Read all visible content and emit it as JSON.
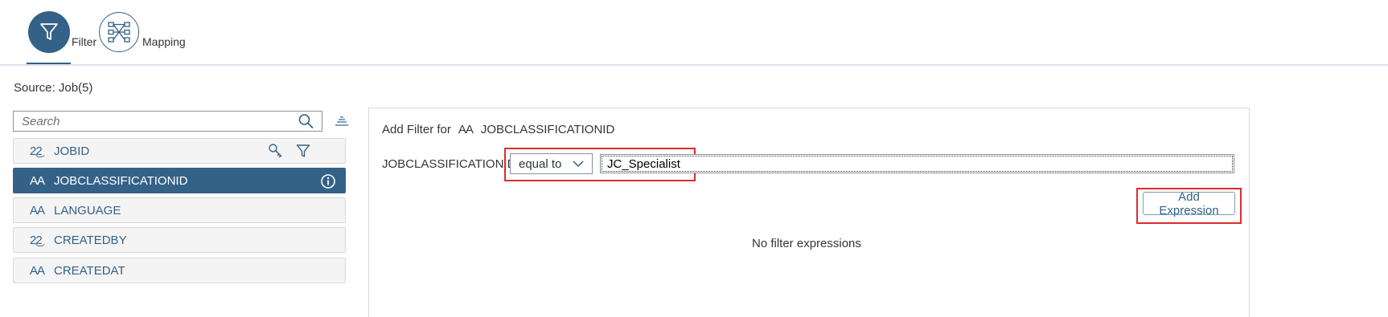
{
  "header": {
    "tabs": [
      {
        "label": "Filter",
        "icon": "funnel-icon",
        "active": true
      },
      {
        "label": "Mapping",
        "icon": "mapping-icon",
        "active": false
      }
    ]
  },
  "source_label": "Source: Job(5)",
  "search": {
    "placeholder": "Search"
  },
  "fields": [
    {
      "type_symbol": "2͜2",
      "type": "number",
      "name": "JOBID"
    },
    {
      "type_symbol": "AA",
      "type": "string",
      "name": "JOBCLASSIFICATIONID",
      "selected": true
    },
    {
      "type_symbol": "AA",
      "type": "string",
      "name": "LANGUAGE"
    },
    {
      "type_symbol": "2͜2",
      "type": "number",
      "name": "CREATEDBY"
    },
    {
      "type_symbol": "AA",
      "type": "string",
      "name": "CREATEDAT"
    }
  ],
  "filter_panel": {
    "title_prefix": "Add Filter for",
    "title_field": "JOBCLASSIFICATIONID",
    "field_label": "JOBCLASSIFICATIONID",
    "operator": "equal to",
    "value": "JC_Specialist",
    "add_expression_label": "Add Expression",
    "empty_text": "No filter expressions"
  },
  "colors": {
    "accent": "#346187",
    "highlight": "#e02b2b",
    "list_bg": "#f4f4f4"
  }
}
